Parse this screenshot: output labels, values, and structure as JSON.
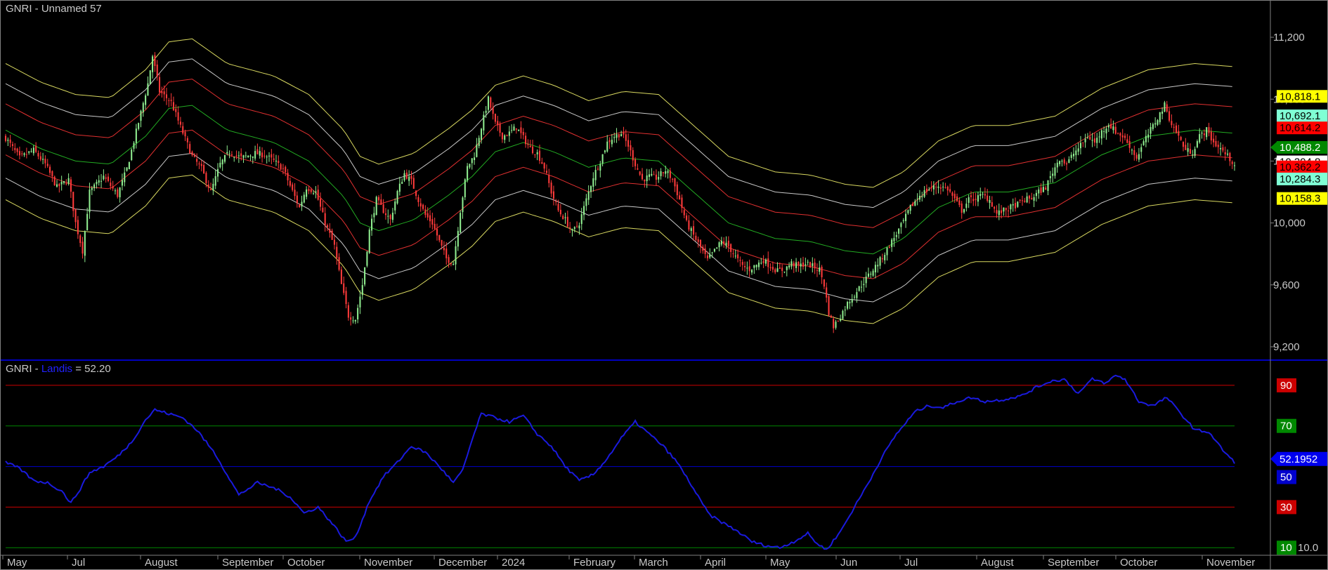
{
  "upper_panel": {
    "symbol": "GNRI",
    "separator": " - ",
    "name": "Unnamed 57"
  },
  "lower_panel": {
    "symbol": "GNRI",
    "separator": " - ",
    "indicator": "Landis",
    "value_text": " = 52.20"
  },
  "colors": {
    "background": "#000000",
    "border": "#808080",
    "panel_divider": "#0000ff",
    "up_candle": "#90ee90",
    "down_candle": "#ff3b3b",
    "band_outer": "#d8d860",
    "band_mid": "#c8c8c8",
    "band_inner": "#e03030",
    "band_center": "#22aa22",
    "oscillator_line": "#1a1add",
    "level_red": "#cc0000",
    "level_green": "#008800",
    "level_blue": "#0000cc"
  },
  "chart_data": [
    {
      "type": "candlestick",
      "title": "GNRI - Unnamed 57",
      "y_ticks": [
        "11,200",
        "10,800",
        "10,400",
        "10,000",
        "9,600",
        "9,200"
      ],
      "ylim": [
        9150,
        11350
      ],
      "x_labels": [
        "May",
        "Jul",
        "August",
        "September",
        "October",
        "November",
        "December",
        "2024",
        "February",
        "March",
        "April",
        "May",
        "Jun",
        "Jul",
        "August",
        "September",
        "October",
        "November"
      ],
      "last_values": [
        {
          "label": "10,818.1",
          "bg": "#ffff00",
          "fg": "#000000"
        },
        {
          "label": "10,692.1",
          "bg": "#7fffd4",
          "fg": "#000000"
        },
        {
          "label": "10,614.2",
          "bg": "#ff0000",
          "fg": "#000000"
        },
        {
          "label": "10,488.2",
          "bg": "#008800",
          "fg": "#ffffff",
          "arrow": true
        },
        {
          "label": "10,394.8",
          "bg": "#ffffff",
          "fg": "#000000"
        },
        {
          "label": "10,362.2",
          "bg": "#ff0000",
          "fg": "#000000"
        },
        {
          "label": "10,284.3",
          "bg": "#7fffd4",
          "fg": "#000000"
        },
        {
          "label": "10,158.3",
          "bg": "#ffff00",
          "fg": "#000000"
        }
      ],
      "close_path": [
        [
          0,
          10550
        ],
        [
          6,
          10420
        ],
        [
          12,
          10470
        ],
        [
          17,
          10380
        ],
        [
          22,
          10230
        ],
        [
          27,
          10280
        ],
        [
          30,
          10000
        ],
        [
          33,
          9820
        ],
        [
          36,
          10200
        ],
        [
          42,
          10300
        ],
        [
          48,
          10180
        ],
        [
          52,
          10350
        ],
        [
          57,
          10650
        ],
        [
          61,
          10900
        ],
        [
          63,
          11080
        ],
        [
          66,
          10850
        ],
        [
          71,
          10780
        ],
        [
          75,
          10620
        ],
        [
          80,
          10430
        ],
        [
          84,
          10350
        ],
        [
          88,
          10200
        ],
        [
          92,
          10380
        ],
        [
          96,
          10460
        ],
        [
          101,
          10420
        ],
        [
          107,
          10450
        ],
        [
          111,
          10440
        ],
        [
          115,
          10400
        ],
        [
          119,
          10350
        ],
        [
          122,
          10240
        ],
        [
          126,
          10100
        ],
        [
          129,
          10230
        ],
        [
          133,
          10200
        ],
        [
          137,
          10000
        ],
        [
          141,
          9850
        ],
        [
          144,
          9600
        ],
        [
          147,
          9400
        ],
        [
          150,
          9380
        ],
        [
          153,
          9600
        ],
        [
          156,
          9950
        ],
        [
          159,
          10150
        ],
        [
          162,
          10080
        ],
        [
          165,
          10020
        ],
        [
          168,
          10200
        ],
        [
          171,
          10320
        ],
        [
          174,
          10270
        ],
        [
          177,
          10150
        ],
        [
          180,
          10050
        ],
        [
          183,
          10000
        ],
        [
          186,
          9880
        ],
        [
          189,
          9770
        ],
        [
          192,
          9740
        ],
        [
          195,
          10080
        ],
        [
          198,
          10360
        ],
        [
          201,
          10440
        ],
        [
          204,
          10620
        ],
        [
          207,
          10800
        ],
        [
          210,
          10640
        ],
        [
          213,
          10560
        ],
        [
          216,
          10580
        ],
        [
          219,
          10620
        ],
        [
          222,
          10550
        ],
        [
          225,
          10480
        ],
        [
          228,
          10450
        ],
        [
          231,
          10360
        ],
        [
          234,
          10200
        ],
        [
          237,
          10080
        ],
        [
          240,
          10020
        ],
        [
          243,
          9940
        ],
        [
          246,
          10000
        ],
        [
          249,
          10150
        ],
        [
          252,
          10300
        ],
        [
          255,
          10400
        ],
        [
          258,
          10520
        ],
        [
          261,
          10560
        ],
        [
          264,
          10580
        ],
        [
          267,
          10500
        ],
        [
          270,
          10380
        ],
        [
          273,
          10280
        ],
        [
          276,
          10300
        ],
        [
          279,
          10290
        ],
        [
          283,
          10340
        ],
        [
          286,
          10280
        ],
        [
          289,
          10150
        ],
        [
          292,
          10000
        ],
        [
          295,
          9920
        ],
        [
          298,
          9840
        ],
        [
          301,
          9760
        ],
        [
          304,
          9820
        ],
        [
          307,
          9880
        ],
        [
          310,
          9850
        ],
        [
          313,
          9780
        ],
        [
          316,
          9720
        ],
        [
          319,
          9700
        ],
        [
          322,
          9730
        ],
        [
          325,
          9760
        ],
        [
          328,
          9720
        ],
        [
          331,
          9690
        ],
        [
          334,
          9700
        ],
        [
          337,
          9740
        ],
        [
          340,
          9720
        ],
        [
          343,
          9740
        ],
        [
          346,
          9720
        ],
        [
          349,
          9700
        ],
        [
          351,
          9600
        ],
        [
          353,
          9420
        ],
        [
          355,
          9330
        ],
        [
          358,
          9400
        ],
        [
          361,
          9480
        ],
        [
          364,
          9540
        ],
        [
          368,
          9620
        ],
        [
          372,
          9700
        ],
        [
          376,
          9780
        ],
        [
          380,
          9880
        ],
        [
          384,
          9980
        ],
        [
          388,
          10100
        ],
        [
          392,
          10180
        ],
        [
          396,
          10220
        ],
        [
          400,
          10240
        ],
        [
          404,
          10220
        ],
        [
          407,
          10150
        ],
        [
          410,
          10080
        ],
        [
          413,
          10150
        ],
        [
          416,
          10160
        ],
        [
          419,
          10180
        ],
        [
          422,
          10150
        ],
        [
          425,
          10060
        ],
        [
          428,
          10080
        ],
        [
          431,
          10100
        ],
        [
          434,
          10120
        ],
        [
          437,
          10150
        ],
        [
          440,
          10160
        ],
        [
          443,
          10200
        ],
        [
          446,
          10230
        ],
        [
          449,
          10330
        ],
        [
          452,
          10420
        ],
        [
          455,
          10380
        ],
        [
          458,
          10450
        ],
        [
          461,
          10500
        ],
        [
          464,
          10560
        ],
        [
          467,
          10520
        ],
        [
          470,
          10590
        ],
        [
          473,
          10640
        ],
        [
          476,
          10590
        ],
        [
          479,
          10560
        ],
        [
          482,
          10500
        ],
        [
          485,
          10420
        ],
        [
          488,
          10520
        ],
        [
          491,
          10600
        ],
        [
          494,
          10680
        ],
        [
          497,
          10760
        ],
        [
          500,
          10640
        ],
        [
          503,
          10560
        ],
        [
          506,
          10470
        ],
        [
          509,
          10460
        ],
        [
          512,
          10560
        ],
        [
          515,
          10600
        ],
        [
          518,
          10520
        ],
        [
          521,
          10480
        ],
        [
          524,
          10430
        ],
        [
          527,
          10380
        ]
      ],
      "center_path": [
        [
          0,
          10600
        ],
        [
          15,
          10480
        ],
        [
          30,
          10400
        ],
        [
          45,
          10380
        ],
        [
          60,
          10560
        ],
        [
          70,
          10740
        ],
        [
          80,
          10760
        ],
        [
          95,
          10600
        ],
        [
          115,
          10520
        ],
        [
          130,
          10400
        ],
        [
          145,
          10170
        ],
        [
          152,
          10000
        ],
        [
          160,
          9950
        ],
        [
          175,
          10020
        ],
        [
          190,
          10180
        ],
        [
          200,
          10300
        ],
        [
          210,
          10460
        ],
        [
          222,
          10520
        ],
        [
          235,
          10460
        ],
        [
          250,
          10360
        ],
        [
          265,
          10420
        ],
        [
          280,
          10400
        ],
        [
          295,
          10200
        ],
        [
          310,
          10000
        ],
        [
          330,
          9900
        ],
        [
          345,
          9880
        ],
        [
          360,
          9820
        ],
        [
          372,
          9800
        ],
        [
          385,
          9900
        ],
        [
          400,
          10100
        ],
        [
          415,
          10200
        ],
        [
          430,
          10200
        ],
        [
          450,
          10260
        ],
        [
          470,
          10440
        ],
        [
          490,
          10560
        ],
        [
          510,
          10600
        ],
        [
          527,
          10580
        ]
      ],
      "band_offsets": [
        {
          "offset": 430,
          "kind": "outer"
        },
        {
          "offset": 300,
          "kind": "mid"
        },
        {
          "offset": 170,
          "kind": "inner"
        },
        {
          "offset": 0,
          "kind": "center"
        },
        {
          "offset": -160,
          "kind": "inner"
        },
        {
          "offset": -310,
          "kind": "mid"
        },
        {
          "offset": -450,
          "kind": "outer"
        }
      ]
    },
    {
      "type": "line",
      "title": "GNRI - Landis = 52.20",
      "ylim": [
        8,
        100
      ],
      "levels": [
        {
          "value": 90,
          "label": "90",
          "color": "red"
        },
        {
          "value": 70,
          "label": "70",
          "color": "green"
        },
        {
          "value": 50,
          "label": "50",
          "color": "blue"
        },
        {
          "value": 30,
          "label": "30",
          "color": "red"
        },
        {
          "value": 10,
          "label": "10",
          "color": "green"
        }
      ],
      "last_value_label": "52.1952",
      "extra_right_labels": [
        "10.0"
      ],
      "series": [
        {
          "values": [
            [
              0,
              52
            ],
            [
              6,
              49
            ],
            [
              12,
              43
            ],
            [
              18,
              42
            ],
            [
              24,
              38
            ],
            [
              28,
              32
            ],
            [
              32,
              39
            ],
            [
              36,
              47
            ],
            [
              42,
              50
            ],
            [
              48,
              55
            ],
            [
              54,
              62
            ],
            [
              60,
              73
            ],
            [
              64,
              78
            ],
            [
              70,
              76
            ],
            [
              76,
              74
            ],
            [
              82,
              68
            ],
            [
              90,
              56
            ],
            [
              96,
              44
            ],
            [
              100,
              36
            ],
            [
              108,
              42
            ],
            [
              116,
              39
            ],
            [
              122,
              35
            ],
            [
              128,
              27
            ],
            [
              134,
              30
            ],
            [
              140,
              22
            ],
            [
              146,
              13
            ],
            [
              150,
              15
            ],
            [
              156,
              33
            ],
            [
              162,
              45
            ],
            [
              168,
              52
            ],
            [
              174,
              60
            ],
            [
              180,
              57
            ],
            [
              186,
              50
            ],
            [
              192,
              42
            ],
            [
              196,
              48
            ],
            [
              200,
              63
            ],
            [
              204,
              76
            ],
            [
              210,
              74
            ],
            [
              216,
              72
            ],
            [
              222,
              75
            ],
            [
              228,
              66
            ],
            [
              234,
              60
            ],
            [
              240,
              50
            ],
            [
              246,
              43
            ],
            [
              252,
              46
            ],
            [
              258,
              54
            ],
            [
              264,
              64
            ],
            [
              270,
              72
            ],
            [
              276,
              66
            ],
            [
              282,
              60
            ],
            [
              288,
              52
            ],
            [
              294,
              41
            ],
            [
              298,
              33
            ],
            [
              302,
              26
            ],
            [
              308,
              22
            ],
            [
              314,
              18
            ],
            [
              320,
              13
            ],
            [
              326,
              11
            ],
            [
              332,
              10
            ],
            [
              338,
              13
            ],
            [
              344,
              17
            ],
            [
              348,
              12
            ],
            [
              352,
              9
            ],
            [
              358,
              18
            ],
            [
              364,
              30
            ],
            [
              370,
              42
            ],
            [
              376,
              55
            ],
            [
              382,
              66
            ],
            [
              390,
              77
            ],
            [
              396,
              80
            ],
            [
              402,
              79
            ],
            [
              408,
              82
            ],
            [
              414,
              84
            ],
            [
              420,
              82
            ],
            [
              428,
              83
            ],
            [
              436,
              85
            ],
            [
              442,
              89
            ],
            [
              448,
              92
            ],
            [
              454,
              93
            ],
            [
              460,
              86
            ],
            [
              466,
              93
            ],
            [
              472,
              91
            ],
            [
              476,
              95
            ],
            [
              480,
              93
            ],
            [
              486,
              82
            ],
            [
              492,
              80
            ],
            [
              498,
              84
            ],
            [
              504,
              76
            ],
            [
              510,
              68
            ],
            [
              516,
              67
            ],
            [
              522,
              58
            ],
            [
              527,
              52
            ]
          ]
        }
      ]
    }
  ]
}
